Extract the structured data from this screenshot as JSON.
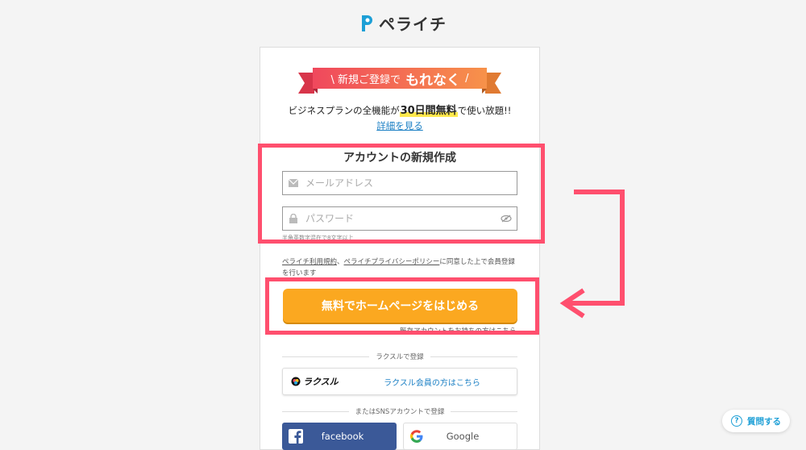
{
  "brand": {
    "name": "ペライチ",
    "color": "#1d9fd6"
  },
  "promo": {
    "ribbon_prefix": "\\ 新規ご登録で",
    "ribbon_strong": "もれなく",
    "ribbon_suffix": "/",
    "plan_before": "ビジネスプランの全機能が",
    "plan_highlight": "30日間無料",
    "plan_after": "で使い放題!!",
    "details_link": "詳細を見る"
  },
  "form": {
    "title": "アカウントの新規作成",
    "email_placeholder": "メールアドレス",
    "password_placeholder": "パスワード",
    "password_hint": "半角英数字混在で8文字以上",
    "terms_link1": "ペライチ利用規約",
    "terms_sep": "、",
    "terms_link2": "ペライチプライバシーポリシー",
    "terms_text": "に同意した上で会員登録を行います",
    "submit_label": "無料でホームページをはじめる",
    "cut_link": "既存アカウントをお持ちの方はこちら"
  },
  "raksul": {
    "divider_label": "ラクスルで登録",
    "logo_text": "ラクスル",
    "button_label": "ラクスル会員の方はこちら"
  },
  "sns": {
    "divider_label": "またはSNSアカウントで登録",
    "facebook_label": "facebook",
    "google_label": "Google"
  },
  "help": {
    "label": "質問する"
  },
  "colors": {
    "highlight": "#ff4f6e",
    "cta": "#fba820",
    "ribbon_start": "#f0485d",
    "ribbon_end": "#f7924a",
    "facebook": "#3b5998",
    "link": "#1a7fc4"
  },
  "icons": {
    "email": "mail-icon",
    "password": "lock-icon",
    "toggle": "eye-slash-icon",
    "arrow": "arrow-left-icon",
    "help": "question-circle-icon"
  }
}
